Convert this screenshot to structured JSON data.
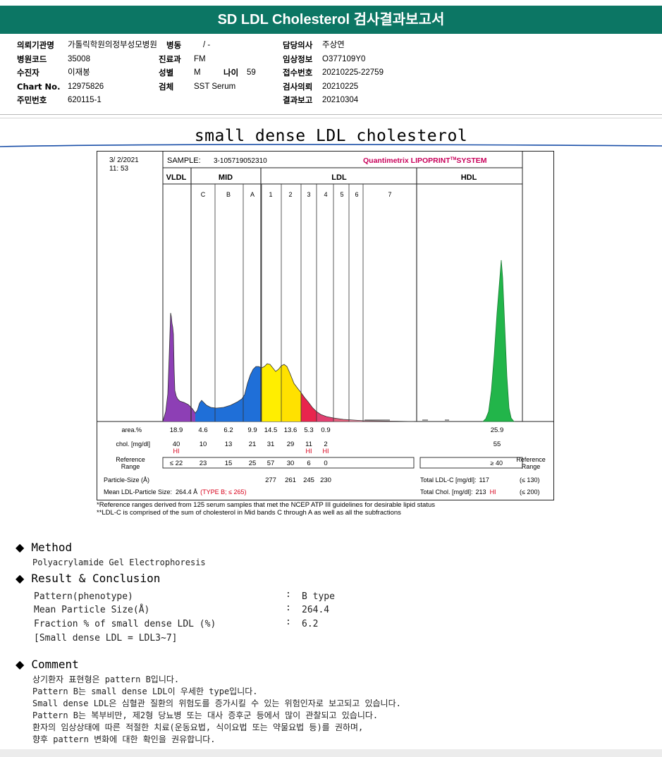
{
  "header": {
    "title": "SD LDL Cholesterol 검사결과보고서"
  },
  "info": {
    "col1": [
      {
        "k": "의뢰기관명",
        "v": "가톨릭학원의정부성모병원"
      },
      {
        "k": "병원코드",
        "v": "35008"
      },
      {
        "k": "수진자",
        "v": "이재봉"
      },
      {
        "k": "Chart No.",
        "v": "12975826"
      },
      {
        "k": "주민번호",
        "v": "620115-1"
      }
    ],
    "col2": {
      "ward_label": "병동",
      "ward_value": "/ -",
      "dept_label": "진료과",
      "dept_value": "FM",
      "sex_label": "성별",
      "sex_value": "M",
      "age_label": "나이",
      "age_value": "59",
      "specimen_label": "검체",
      "specimen_value": "SST Serum"
    },
    "col3": [
      {
        "k": "담당의사",
        "v": "주상연"
      },
      {
        "k": "임상정보",
        "v": "O377109Y0"
      },
      {
        "k": "접수번호",
        "v": "20210225-22759"
      },
      {
        "k": "검사의뢰",
        "v": "20210225"
      },
      {
        "k": "결과보고",
        "v": "20210304"
      }
    ]
  },
  "subtitle": "small dense LDL cholesterol",
  "chart_data": {
    "type": "area",
    "date": "3/ 2/2021",
    "time": "11: 53",
    "sample_label": "SAMPLE:",
    "sample_id": "3-105719052310",
    "brand": "Quantimetrix LIPOPRINT",
    "brand_tm": "TM",
    "brand_tail": "SYSTEM",
    "groups": [
      "VLDL",
      "MID",
      "LDL",
      "HDL"
    ],
    "mid_bands": [
      "C",
      "B",
      "A"
    ],
    "ldl_bands": [
      "1",
      "2",
      "3",
      "4",
      "5",
      "6",
      "7"
    ],
    "row_labels": {
      "area": "area.%",
      "chol": "chol. [mg/dl]",
      "ref1": "Reference",
      "ref2": "Range",
      "psize": "Particle-Size (Å)",
      "mean": "Mean LDL-Particle Size:",
      "hdl_ref1": "Reference",
      "hdl_ref2": "Range"
    },
    "area_values": [
      "18.9",
      "4.6",
      "6.2",
      "9.9",
      "14.5",
      "13.6",
      "5.3",
      "0.9",
      "25.9"
    ],
    "chol_values": [
      "40",
      "10",
      "13",
      "21",
      "31",
      "29",
      "11",
      "2",
      "55"
    ],
    "chol_flags": [
      "HI",
      "",
      "",
      "",
      "",
      "",
      "HI",
      "HI",
      ""
    ],
    "ref_values": [
      "≤ 22",
      "23",
      "15",
      "25",
      "57",
      "30",
      "6",
      "0"
    ],
    "hdl_ref": "≥ 40",
    "particle_sizes": [
      "277",
      "261",
      "245",
      "230"
    ],
    "mean_size": "264.4 Å",
    "mean_type": "(TYPE B; ≤ 265)",
    "total_ldl_label": "Total LDL-C [mg/dl]:",
    "total_ldl_value": "117",
    "total_ldl_ref": "(≤ 130)",
    "total_chol_label": "Total Chol. [mg/dl]:",
    "total_chol_value": "213",
    "total_chol_flag": "HI",
    "total_chol_ref": "(≤ 200)",
    "colors": {
      "vldl": "#8d3fb5",
      "mid": "#1f6fd8",
      "ldl1": "#ffee00",
      "ldl2": "#ffe100",
      "ldl3": "#e8254d",
      "ldl4": "#e04070",
      "hdl": "#22b54a",
      "flag": "#d8001a",
      "brand": "#c8005a"
    }
  },
  "footnotes": [
    "*Reference ranges derived from 125 serum samples that met the NCEP ATP III guidelines for desirable lipid status",
    "**LDL-C is comprised of the sum of cholesterol in Mid bands C through A as well as all the subfractions"
  ],
  "method": {
    "heading": "Method",
    "text": "Polyacrylamide Gel Electrophoresis"
  },
  "result": {
    "heading": "Result & Conclusion",
    "rows": [
      {
        "k": "Pattern(phenotype)",
        "v": "B type"
      },
      {
        "k": "Mean Particle Size(Å)",
        "v": "264.4"
      },
      {
        "k": "Fraction % of small dense LDL (%)",
        "v": "6.2"
      }
    ],
    "note": "[Small dense LDL = LDL3~7]",
    "colon": ":"
  },
  "comment": {
    "heading": "Comment",
    "lines": [
      "상기환자 표현형은 pattern B입니다.",
      "Pattern B는 small dense LDL이 우세한 type입니다.",
      "Small dense LDL은 심혈관 질환의 위험도를 증가시킬 수 있는 위험인자로 보고되고 있습니다.",
      "Pattern B는 복부비만, 제2형 당뇨병 또는 대사 증후군 등에서 많이 관찰되고 있습니다.",
      "환자의 임상상태에 따른 적절한 치료(운동요법, 식이요법 또는 약물요법 등)를 권하며,",
      "향후 pattern 변화에 대한 확인을 권유합니다."
    ]
  }
}
